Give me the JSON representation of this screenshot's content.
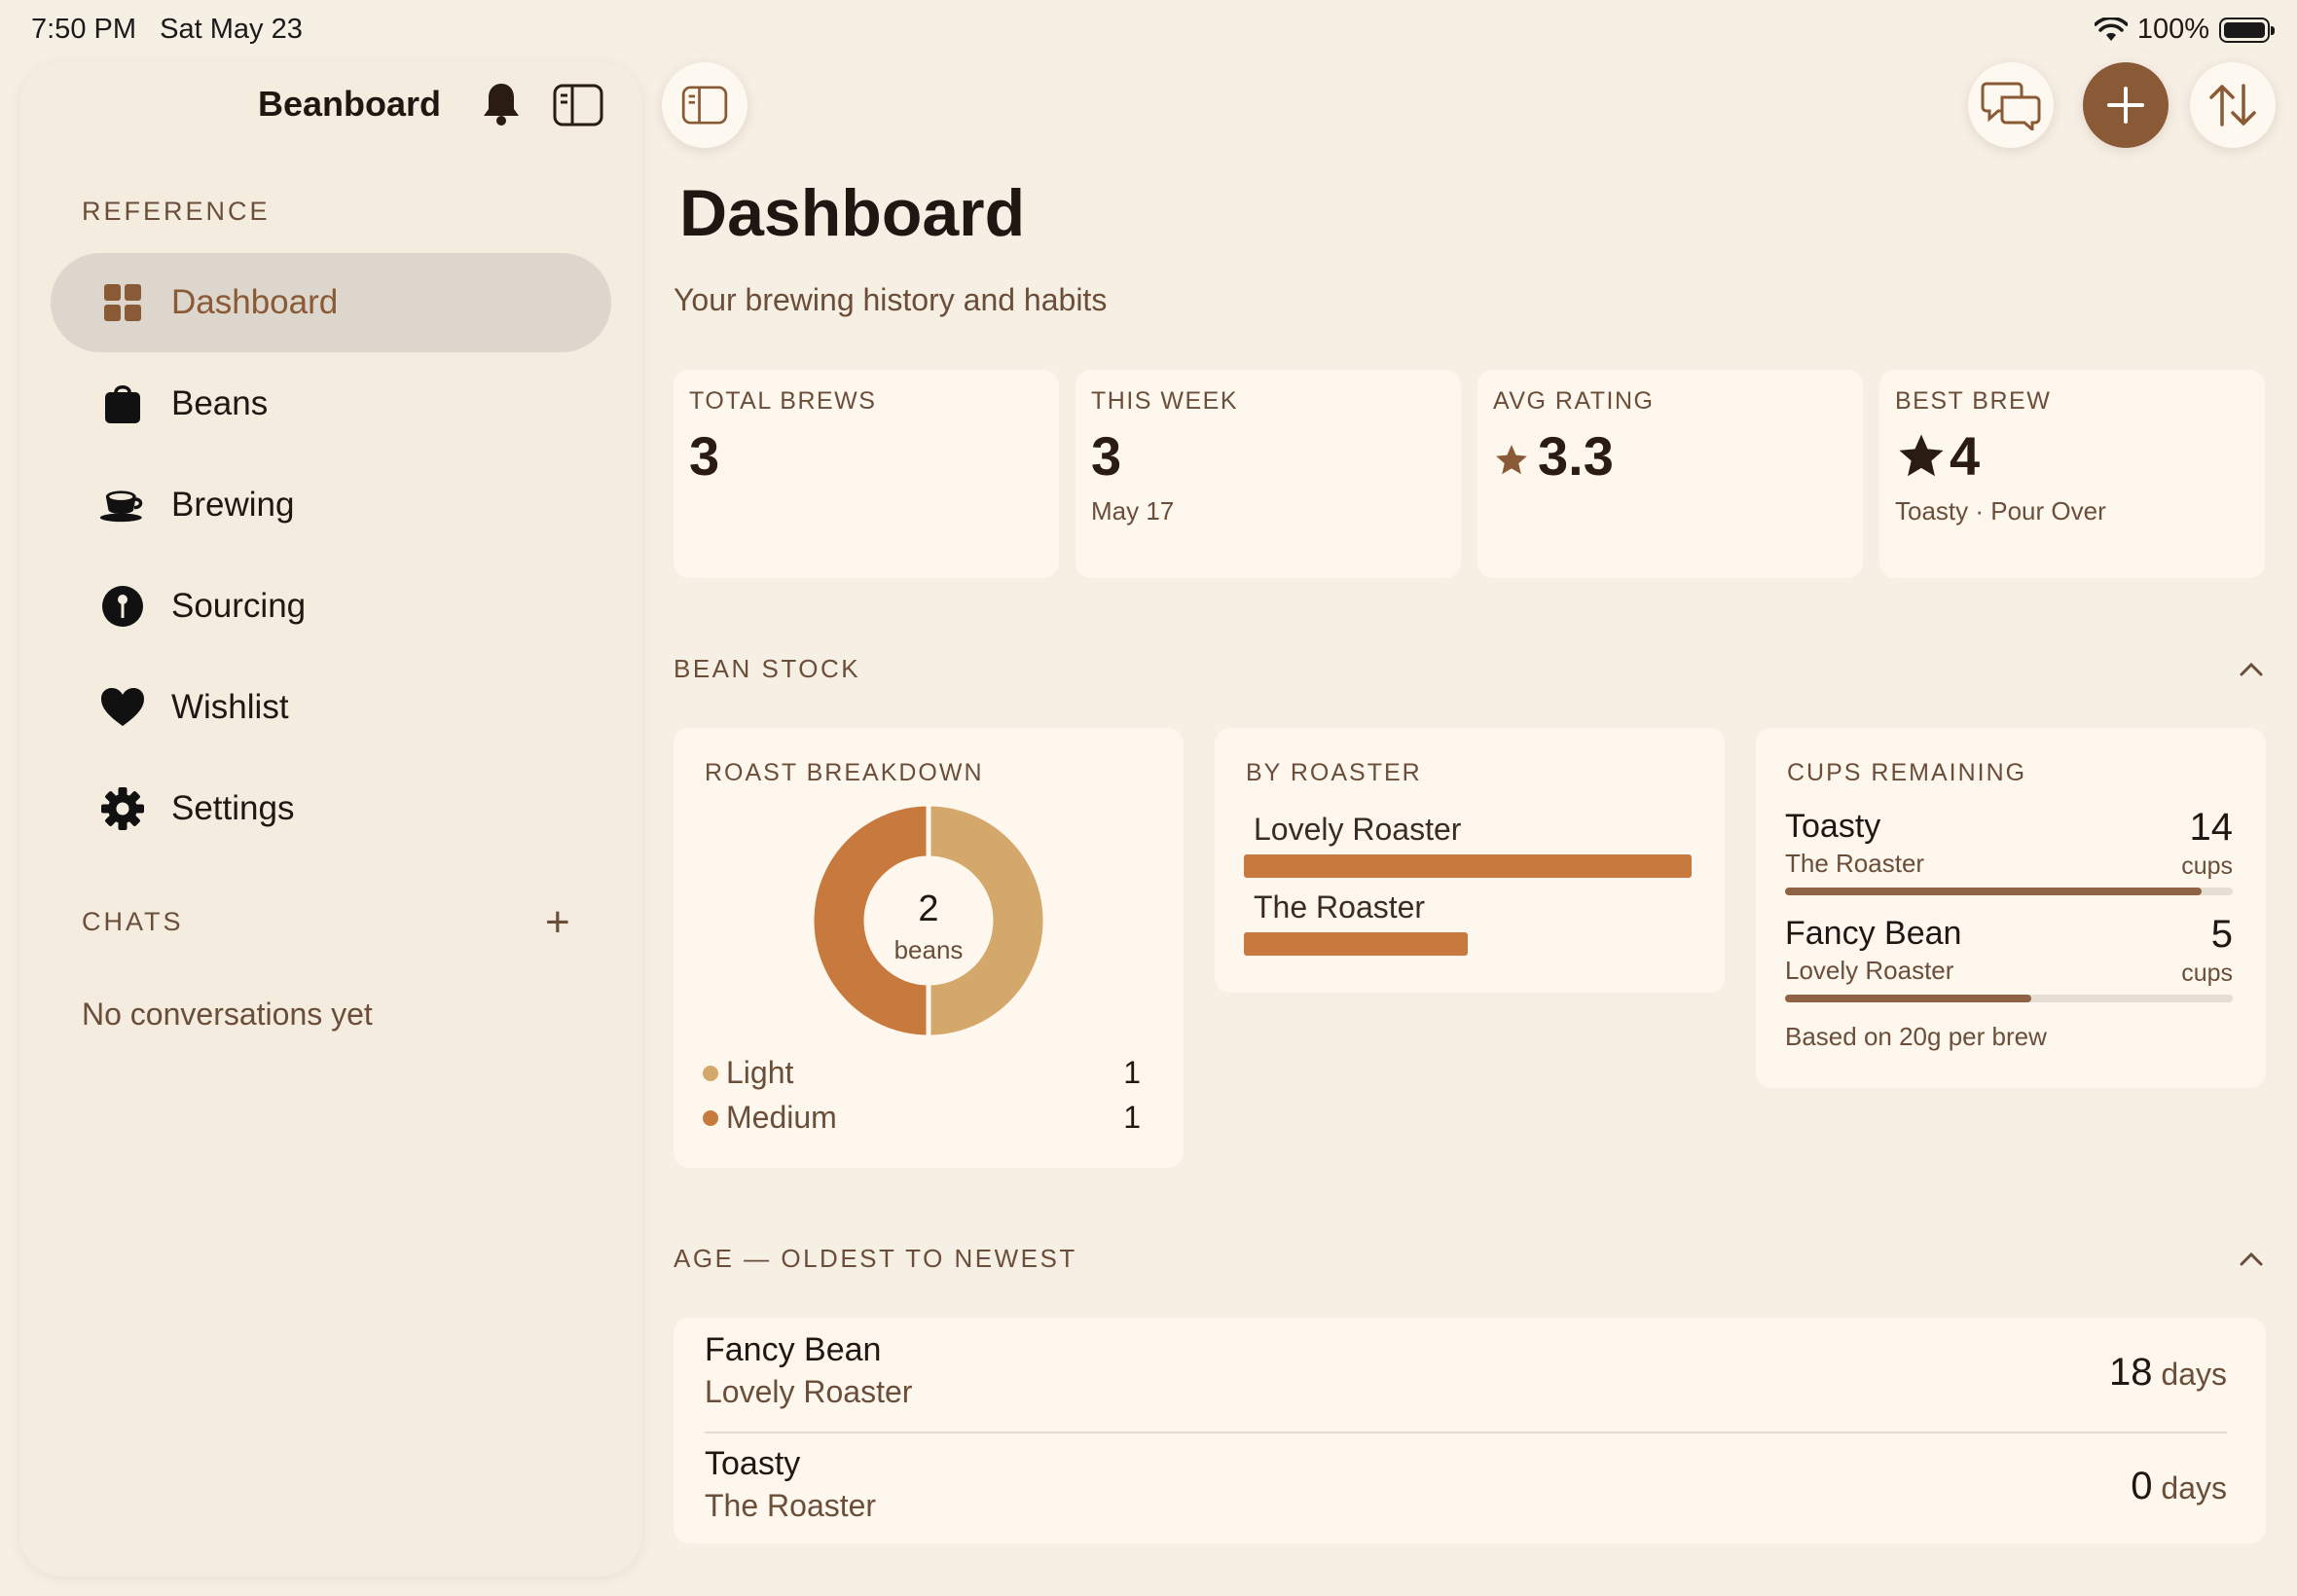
{
  "status": {
    "time": "7:50 PM",
    "date": "Sat May 23",
    "battery": "100%"
  },
  "sidebar": {
    "title": "Beanboard",
    "reference_label": "REFERENCE",
    "items": [
      {
        "label": "Dashboard",
        "icon": "grid-icon",
        "active": true
      },
      {
        "label": "Beans",
        "icon": "bag-icon"
      },
      {
        "label": "Brewing",
        "icon": "cup-icon"
      },
      {
        "label": "Sourcing",
        "icon": "pin-icon"
      },
      {
        "label": "Wishlist",
        "icon": "heart-icon"
      },
      {
        "label": "Settings",
        "icon": "gear-icon"
      }
    ],
    "chats_label": "CHATS",
    "chats_empty": "No conversations yet"
  },
  "toolbar": {
    "chat_icon": "chat-bubbles-icon",
    "add_icon": "plus-icon",
    "sort_icon": "sort-arrows-icon"
  },
  "header": {
    "title": "Dashboard",
    "subtitle": "Your brewing history and habits"
  },
  "stats": [
    {
      "label": "TOTAL BREWS",
      "value": "3",
      "sub": ""
    },
    {
      "label": "THIS WEEK",
      "value": "3",
      "sub": "May 17"
    },
    {
      "label": "AVG RATING",
      "value": "3.3",
      "sub": "",
      "icon": "star-icon"
    },
    {
      "label": "BEST BREW",
      "value": "4",
      "sub": "Toasty · Pour Over",
      "icon": "star-icon"
    }
  ],
  "bean_stock": {
    "section_label": "BEAN STOCK",
    "roast": {
      "label": "ROAST BREAKDOWN",
      "center_value": "2",
      "center_unit": "beans",
      "legend": [
        {
          "name": "Light",
          "count": "1",
          "color": "#d4a86a"
        },
        {
          "name": "Medium",
          "count": "1",
          "color": "#c87a3e"
        }
      ]
    },
    "by_roaster": {
      "label": "BY ROASTER",
      "rows": [
        {
          "name": "Lovely Roaster",
          "share": 1.0
        },
        {
          "name": "The Roaster",
          "share": 0.5
        }
      ]
    },
    "cups": {
      "label": "CUPS REMAINING",
      "rows": [
        {
          "name": "Toasty",
          "roaster": "The Roaster",
          "value": "14",
          "unit": "cups",
          "fill": 0.93
        },
        {
          "name": "Fancy Bean",
          "roaster": "Lovely Roaster",
          "value": "5",
          "unit": "cups",
          "fill": 0.55
        }
      ],
      "note": "Based on 20g per brew"
    }
  },
  "age": {
    "section_label": "AGE — OLDEST TO NEWEST",
    "rows": [
      {
        "name": "Fancy Bean",
        "roaster": "Lovely Roaster",
        "value": "18",
        "unit": "days"
      },
      {
        "name": "Toasty",
        "roaster": "The Roaster",
        "value": "0",
        "unit": "days"
      }
    ]
  }
}
